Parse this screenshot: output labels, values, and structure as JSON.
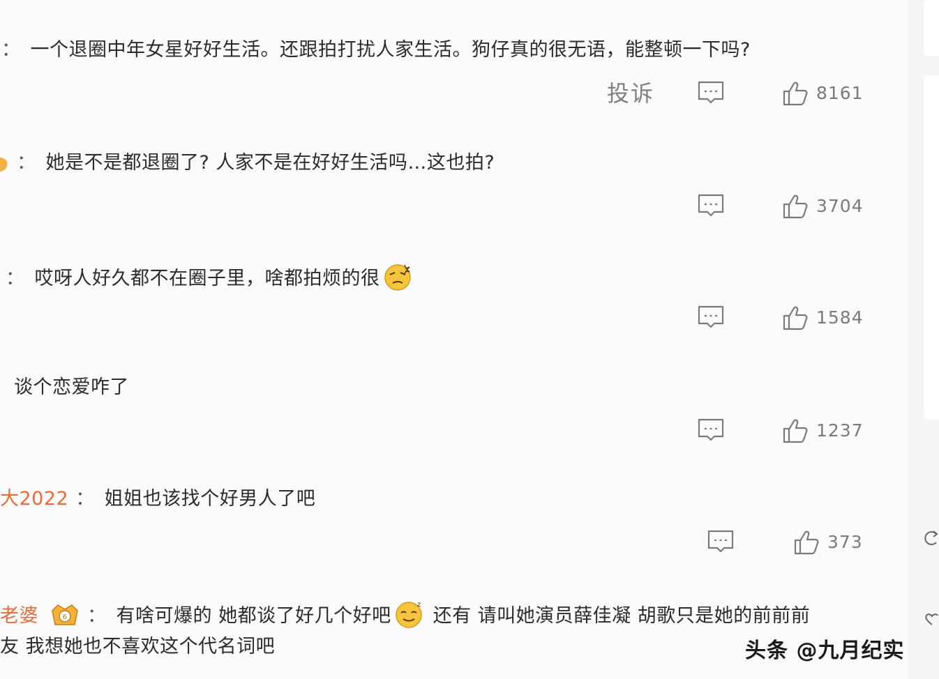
{
  "comments": [
    {
      "user": "",
      "text": "一个退圈中年女星好好生活。还跟拍打扰人家生活。狗仔真的很无语，能整顿一下吗?",
      "report_label": "投诉",
      "likes": "8161"
    },
    {
      "user": "",
      "text": "她是不是都退圈了? 人家不是在好好生活吗…这也拍?",
      "likes": "3704"
    },
    {
      "user": "",
      "text": "哎呀人好久都不在圈子里，啥都拍烦的很",
      "emoji": "dizzy-face-emoji",
      "likes": "1584"
    },
    {
      "user": "",
      "text": "谈个恋爱咋了",
      "likes": "1237"
    },
    {
      "user": "大2022",
      "text": "姐姐也该找个好男人了吧",
      "likes": "373"
    },
    {
      "user": "老婆",
      "text": "有啥可爆的 她都谈了好几个好吧",
      "emoji": "sleepy-face-emoji",
      "text_after": "还有 请叫她演员薛佳凝 胡歌只是她的前前前",
      "text_line2": "友 我想她也不喜欢这个代名词吧"
    }
  ],
  "separator": "：",
  "watermark": "头条 @九月纪实",
  "colors": {
    "username": "#e86b3a",
    "icon": "#7a7a7a",
    "background": "#fbfbfc"
  }
}
